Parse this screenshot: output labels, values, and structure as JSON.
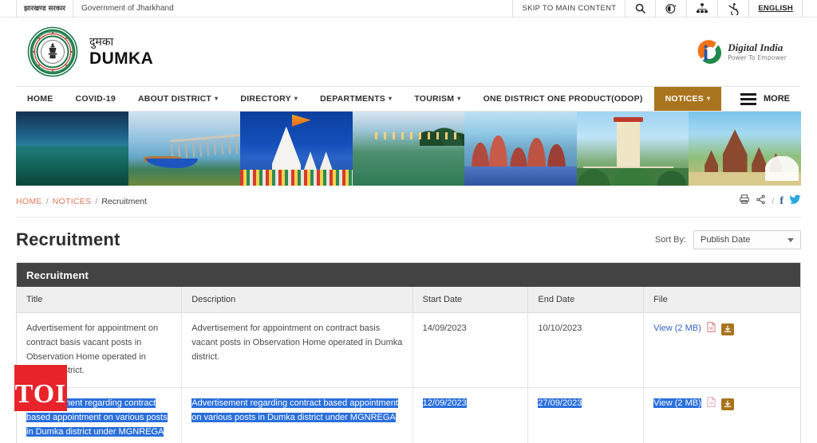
{
  "topbar": {
    "gov_hindi": "झारखण्ड सरकार",
    "gov_english": "Government of Jharkhand",
    "skip_link": "SKIP TO MAIN CONTENT",
    "search_icon": "search-icon",
    "accessibility_theme_icon": "accessibility-theme-icon",
    "sitemap_icon": "sitemap-icon",
    "wheelchair_icon": "accessibility-wheelchair-icon",
    "language": "ENGLISH"
  },
  "header": {
    "emblem_alt": "jharkhand-government-emblem",
    "district_hindi": "दुमका",
    "district_english": "DUMKA",
    "digital_india_title": "Digital India",
    "digital_india_tagline": "Power To Empower"
  },
  "nav": {
    "items": [
      {
        "label": "HOME",
        "has_caret": false,
        "active": false
      },
      {
        "label": "COVID-19",
        "has_caret": false,
        "active": false
      },
      {
        "label": "ABOUT DISTRICT",
        "has_caret": true,
        "active": false
      },
      {
        "label": "DIRECTORY",
        "has_caret": true,
        "active": false
      },
      {
        "label": "DEPARTMENTS",
        "has_caret": true,
        "active": false
      },
      {
        "label": "TOURISM",
        "has_caret": true,
        "active": false
      },
      {
        "label": "ONE DISTRICT ONE PRODUCT(ODOP)",
        "has_caret": false,
        "active": false
      },
      {
        "label": "NOTICES",
        "has_caret": true,
        "active": true
      }
    ],
    "more_label": "MORE",
    "active_color": "#a9741e"
  },
  "banner": {
    "alt": "dumka-tourism-photo-collage"
  },
  "breadcrumb": {
    "home": "HOME",
    "sep": "/",
    "notices": "NOTICES",
    "current": "Recruitment",
    "link_color": "#e07a5a"
  },
  "share": {
    "print_icon": "printer-icon",
    "share_icon": "share-icon",
    "separator": "/",
    "facebook_label": "f",
    "twitter_icon": "twitter-bird-icon"
  },
  "main": {
    "page_title": "Recruitment",
    "sort_label": "Sort By:",
    "sort_value": "Publish Date"
  },
  "table": {
    "caption": "Recruitment",
    "columns": [
      "Title",
      "Description",
      "Start Date",
      "End Date",
      "File"
    ],
    "rows": [
      {
        "title": "Advertisement for appointment on contract basis vacant posts in Observation Home operated in Dumka district.",
        "description": "Advertisement for appointment on contract basis vacant posts in Observation Home operated in Dumka district.",
        "start_date": "14/09/2023",
        "end_date": "10/10/2023",
        "file_label": "View (2 MB)",
        "pdf_icon": "pdf-file-icon",
        "download_icon": "download-icon",
        "selected": false
      },
      {
        "title": "Advertisement regarding contract based appointment on various posts in Dumka district under MGNREGA",
        "description": "Advertisement regarding contract based appointment on various posts in Dumka district under MGNREGA",
        "start_date": "12/09/2023",
        "end_date": "27/09/2023",
        "file_label": "View (2 MB)",
        "pdf_icon": "pdf-file-icon",
        "download_icon": "download-icon",
        "selected": true
      }
    ],
    "header_bg": "#434343",
    "selection_color": "#2a6fdb"
  },
  "watermark": {
    "label": "TOI",
    "color": "#e8232a"
  }
}
